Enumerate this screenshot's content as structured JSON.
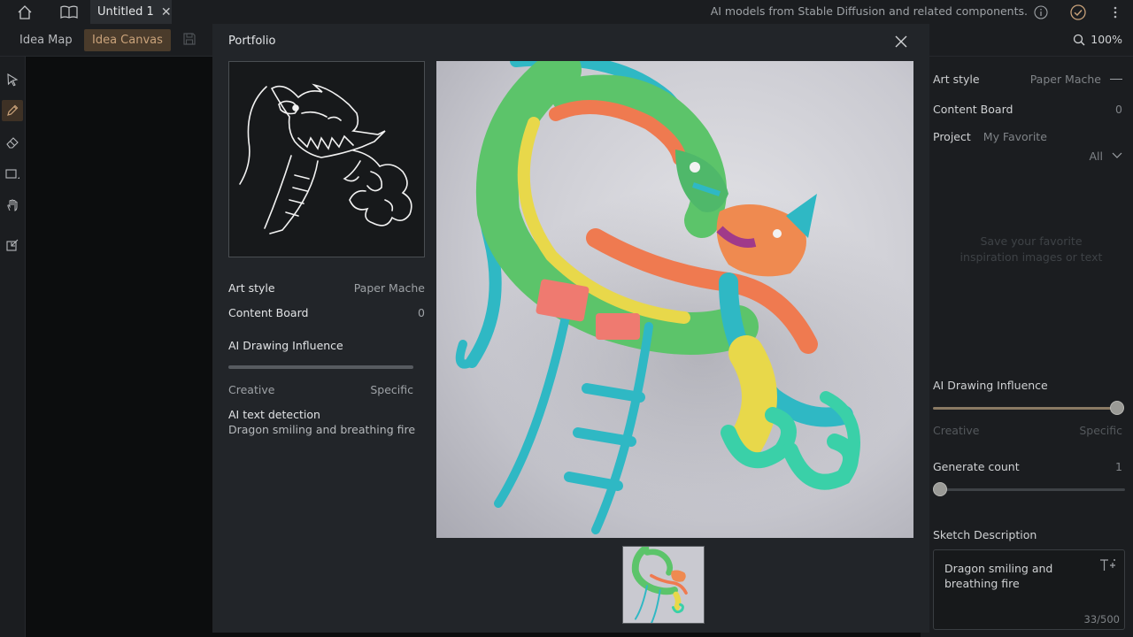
{
  "tabs": {
    "home_icon": "home-icon",
    "book_icon": "book-icon",
    "active_tab": {
      "label": "Untitled 1"
    },
    "close_glyph": "✕"
  },
  "topbar": {
    "info_text": "AI models from Stable Diffusion and related components.",
    "info_icon": "info-icon",
    "check_icon": "check-circle-icon",
    "menu_icon": "more-vertical-icon"
  },
  "modes": {
    "idea_map": "Idea Map",
    "idea_canvas": "Idea Canvas",
    "save_icon": "save-icon"
  },
  "zoom": {
    "value": "100%",
    "icon": "search-icon"
  },
  "tools": [
    "pointer-icon",
    "pencil-icon",
    "eraser-icon",
    "rectangle-icon",
    "hand-icon",
    "import-icon"
  ],
  "right_panel": {
    "art_style_label": "Art style",
    "art_style_value": "Paper Mache",
    "content_board_label": "Content Board",
    "content_board_value": "0",
    "project_label": "Project",
    "project_value": "My Favorite",
    "filter_value": "All",
    "empty_text": "Save your favorite inspiration images or text",
    "influence_label": "AI Drawing Influence",
    "influence_level": 1.0,
    "creative": "Creative",
    "specific": "Specific",
    "generate_label": "Generate count",
    "generate_value": "1",
    "sketch_label": "Sketch Description",
    "sketch_text": "Dragon smiling and breathing fire",
    "sketch_count": "33/500"
  },
  "modal": {
    "title": "Portfolio",
    "art_style_label": "Art style",
    "art_style_value": "Paper Mache",
    "content_board_label": "Content Board",
    "content_board_value": "0",
    "influence_label": "AI Drawing Influence",
    "creative": "Creative",
    "specific": "Specific",
    "detect_label": "AI text detection",
    "detect_text": "Dragon smiling and breathing fire"
  },
  "colors": {
    "accent": "#c9a27a",
    "accent_bg": "#4a3b2b",
    "panel": "#1b1d20",
    "modal": "#222529"
  }
}
